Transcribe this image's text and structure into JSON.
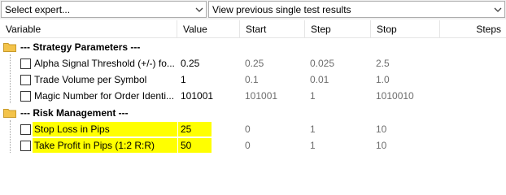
{
  "toolbar": {
    "expert_select": "Select expert...",
    "results_select": "View previous single test results"
  },
  "columns": [
    "Variable",
    "Value",
    "Start",
    "Step",
    "Stop",
    "Steps"
  ],
  "groups": [
    {
      "title": "--- Strategy Parameters ---",
      "rows": [
        {
          "name": "Alpha Signal Threshold (+/-) fo...",
          "value": "0.25",
          "start": "0.25",
          "step": "0.025",
          "stop": "2.5",
          "checked": false,
          "highlighted": false
        },
        {
          "name": "Trade Volume per Symbol",
          "value": "1",
          "start": "0.1",
          "step": "0.01",
          "stop": "1.0",
          "checked": false,
          "highlighted": false
        },
        {
          "name": "Magic Number for Order Identi...",
          "value": "101001",
          "start": "101001",
          "step": "1",
          "stop": "1010010",
          "checked": false,
          "highlighted": false
        }
      ]
    },
    {
      "title": "--- Risk Management ---",
      "rows": [
        {
          "name": "Stop Loss in Pips",
          "value": "25",
          "start": "0",
          "step": "1",
          "stop": "10",
          "checked": false,
          "highlighted": true
        },
        {
          "name": "Take Profit in Pips (1:2 R:R)",
          "value": "50",
          "start": "0",
          "step": "1",
          "stop": "10",
          "checked": false,
          "highlighted": true
        }
      ]
    }
  ],
  "colors": {
    "highlight": "#ffff00",
    "folder": "#f3c34a",
    "disabled_text": "#6d6d6d",
    "header_separator": "#e5e5e5"
  },
  "icons": {
    "group_icon": "folder-icon",
    "dropdown_icon": "chevron-down-icon"
  }
}
